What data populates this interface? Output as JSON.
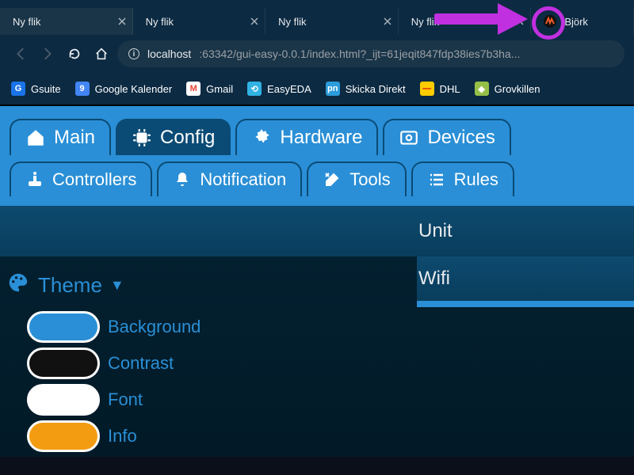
{
  "browser": {
    "tabs": [
      {
        "label": "Ny flik",
        "active": false
      },
      {
        "label": "Ny flik",
        "active": false
      },
      {
        "label": "Ny flik",
        "active": false
      },
      {
        "label": "Ny flik",
        "active": false
      },
      {
        "label": "Björk",
        "active": false
      }
    ],
    "url_host": "localhost",
    "url_rest": ":63342/gui-easy-0.0.1/index.html?_ijt=61jeqit847fdp38ies7b3ha...",
    "bookmarks": [
      {
        "label": "Gsuite",
        "fav_bg": "#1a73e8",
        "fav_txt": "G",
        "fav_color": "#fff"
      },
      {
        "label": "Google Kalender",
        "fav_bg": "#4285f4",
        "fav_txt": "9",
        "fav_color": "#fff"
      },
      {
        "label": "Gmail",
        "fav_bg": "#ffffff",
        "fav_txt": "M",
        "fav_color": "#ea4335"
      },
      {
        "label": "EasyEDA",
        "fav_bg": "#31b2e4",
        "fav_txt": "⟲",
        "fav_color": "#fff"
      },
      {
        "label": "Skicka Direkt",
        "fav_bg": "#2b9cdb",
        "fav_txt": "pn",
        "fav_color": "#fff"
      },
      {
        "label": "DHL",
        "fav_bg": "#ffcc00",
        "fav_txt": "—",
        "fav_color": "#d40511"
      },
      {
        "label": "Grovkillen",
        "fav_bg": "#95bf47",
        "fav_txt": "◆",
        "fav_color": "#fff"
      }
    ]
  },
  "nav": {
    "row1": [
      {
        "label": "Main",
        "active": false
      },
      {
        "label": "Config",
        "active": true
      },
      {
        "label": "Hardware",
        "active": false
      },
      {
        "label": "Devices",
        "active": false
      }
    ],
    "row2": [
      {
        "label": "Controllers",
        "active": false
      },
      {
        "label": "Notification",
        "active": false
      },
      {
        "label": "Tools",
        "active": false
      },
      {
        "label": "Rules",
        "active": false
      }
    ]
  },
  "section": {
    "unit": "Unit",
    "wifi": "Wifi"
  },
  "theme": {
    "title": "Theme",
    "swatches": [
      {
        "label": "Background",
        "bg": "#2a8fd6",
        "border": "#ffffff"
      },
      {
        "label": "Contrast",
        "bg": "#111111",
        "border": "#ffffff"
      },
      {
        "label": "Font",
        "bg": "#ffffff",
        "border": "#ffffff"
      },
      {
        "label": "Info",
        "bg": "#f39c12",
        "border": "#ffffff"
      }
    ]
  }
}
